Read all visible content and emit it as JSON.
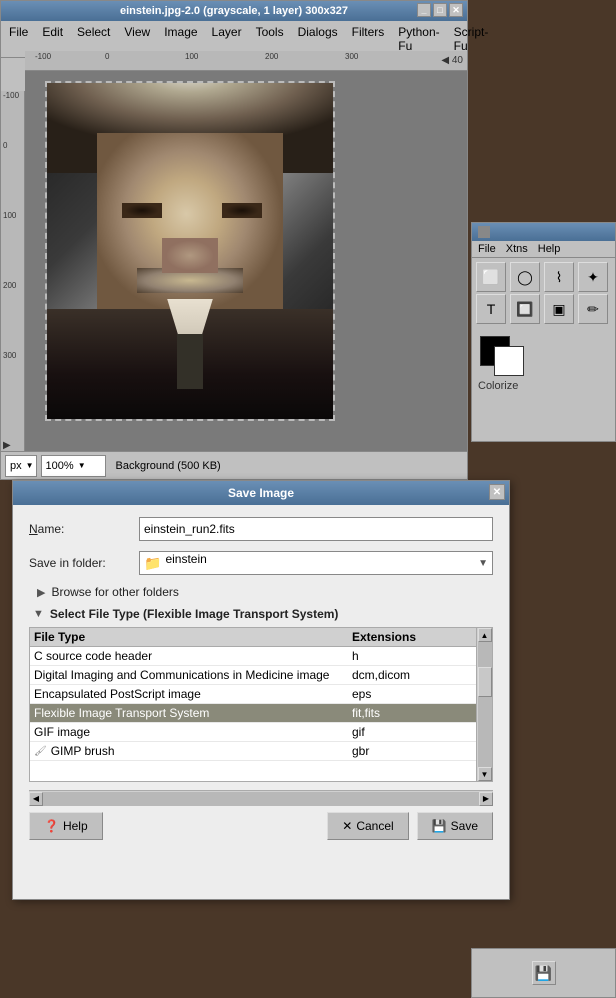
{
  "gimp_window": {
    "title": "einstein.jpg-2.0 (grayscale, 1 layer) 300x327",
    "min_btn": "_",
    "max_btn": "□",
    "close_btn": "✕",
    "menubar": {
      "items": [
        "File",
        "Edit",
        "Select",
        "View",
        "Image",
        "Layer",
        "Tools",
        "Dialogs",
        "Filters",
        "Python-Fu",
        "Script-Fu"
      ]
    },
    "statusbar": {
      "unit": "px",
      "zoom": "100%",
      "background_info": "Background (500 KB)"
    },
    "ruler": {
      "h_labels": [
        "-100",
        "0",
        "100",
        "200",
        "300"
      ],
      "v_labels": [
        "-100",
        "0",
        "100",
        "200",
        "300"
      ]
    }
  },
  "toolbox": {
    "icon": "🎨",
    "menubar": {
      "file": "File",
      "xtns": "Xtns",
      "help": "Help"
    },
    "tools": [
      {
        "name": "marquee-rect-icon",
        "symbol": "⬜"
      },
      {
        "name": "marquee-ellipse-icon",
        "symbol": "⭕"
      },
      {
        "name": "lasso-icon",
        "symbol": "🔗"
      },
      {
        "name": "fuzzy-select-icon",
        "symbol": "✨"
      },
      {
        "name": "text-icon",
        "symbol": "T"
      },
      {
        "name": "bucket-fill-icon",
        "symbol": "🪣"
      },
      {
        "name": "rect-select-icon",
        "symbol": "⬛"
      },
      {
        "name": "eraser-icon",
        "symbol": "✏"
      }
    ],
    "fg_color": "#000000",
    "bg_color": "#ffffff",
    "colorize_label": "Colorize"
  },
  "save_dialog": {
    "title": "Save Image",
    "close_btn": "✕",
    "name_label": "Name:",
    "name_value": "einstein_run2.fits",
    "folder_label": "Save in folder:",
    "folder_value": "einstein",
    "browse_label": "Browse for other folders",
    "filetype_section": "Select File Type (Flexible Image Transport System)",
    "table": {
      "col_filetype": "File Type",
      "col_extensions": "Extensions",
      "rows": [
        {
          "name": "C source code header",
          "ext": "h",
          "selected": false,
          "icon": false
        },
        {
          "name": "Digital Imaging and Communications in Medicine image",
          "ext": "dcm,dicom",
          "selected": false,
          "icon": false
        },
        {
          "name": "Encapsulated PostScript image",
          "ext": "eps",
          "selected": false,
          "icon": false
        },
        {
          "name": "Flexible Image Transport System",
          "ext": "fit,fits",
          "selected": true,
          "icon": false
        },
        {
          "name": "GIF image",
          "ext": "gif",
          "selected": false,
          "icon": false
        },
        {
          "name": "GIMP brush",
          "ext": "gbr",
          "selected": false,
          "icon": true
        }
      ]
    },
    "buttons": {
      "help_label": "Help",
      "cancel_label": "Cancel",
      "save_label": "Save"
    }
  },
  "bottom_panel": {
    "icon": "💾"
  }
}
